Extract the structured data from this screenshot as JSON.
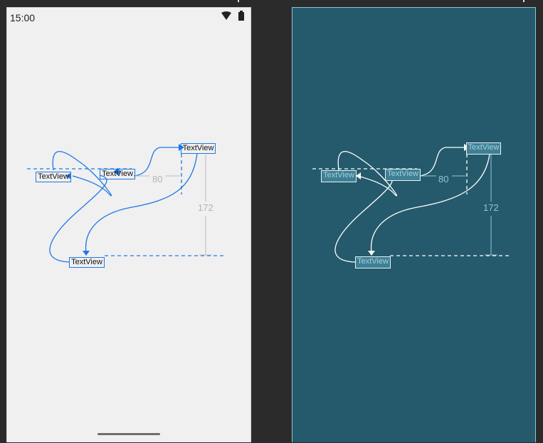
{
  "status_bar": {
    "time": "15:00"
  },
  "views": {
    "tv1": "TextView",
    "tv2": "TextView",
    "tv3": "TextView",
    "tv4": "TextView"
  },
  "dimensions": {
    "horizontal_margin": "80",
    "vertical_margin": "172"
  },
  "colors": {
    "design_background": "#f0f0f0",
    "blueprint_background": "#245a6c",
    "constraint_accent": "#1e78e6",
    "blueprint_line": "#ffffff"
  },
  "icons": [
    "wifi-icon",
    "battery-icon"
  ]
}
